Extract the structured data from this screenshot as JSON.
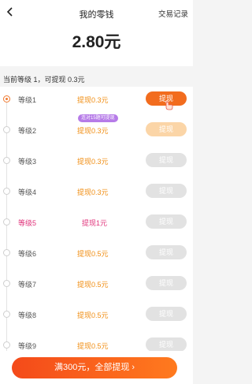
{
  "header": {
    "title": "我的零钱",
    "records_label": "交易记录",
    "balance": "2.80元"
  },
  "level_info": "当前等级 1，可提现 0.3元",
  "levels": [
    {
      "name": "等级1",
      "amount": "提现0.3元",
      "button": "提现",
      "state": "active"
    },
    {
      "name": "等级2",
      "amount": "提现0.3元",
      "button": "提现",
      "state": "pending",
      "badge": "连对15题可提现"
    },
    {
      "name": "等级3",
      "amount": "提现0.3元",
      "button": "提现",
      "state": "locked"
    },
    {
      "name": "等级4",
      "amount": "提现0.3元",
      "button": "提现",
      "state": "locked"
    },
    {
      "name": "等级5",
      "amount": "提现1元",
      "button": "提现",
      "state": "locked",
      "special": true
    },
    {
      "name": "等级6",
      "amount": "提现0.5元",
      "button": "提现",
      "state": "locked"
    },
    {
      "name": "等级7",
      "amount": "提现0.5元",
      "button": "提现",
      "state": "locked"
    },
    {
      "name": "等级8",
      "amount": "提现0.5元",
      "button": "提现",
      "state": "locked"
    },
    {
      "name": "等级9",
      "amount": "提现0.5元",
      "button": "提现",
      "state": "locked"
    }
  ],
  "footer": {
    "withdraw_all_label": "满300元，全部提现",
    "chevron": "›"
  },
  "icons": {
    "back": "back-arrow-icon",
    "hand": "pointing-hand-icon",
    "chevron": "chevron-right-icon"
  },
  "colors": {
    "accent": "#f26c1e",
    "amount": "#f08c10",
    "special": "#e0327a",
    "badge": "#b67be8",
    "disabled_button": "#e2e2e2",
    "pending_button": "#fbd5a7"
  }
}
